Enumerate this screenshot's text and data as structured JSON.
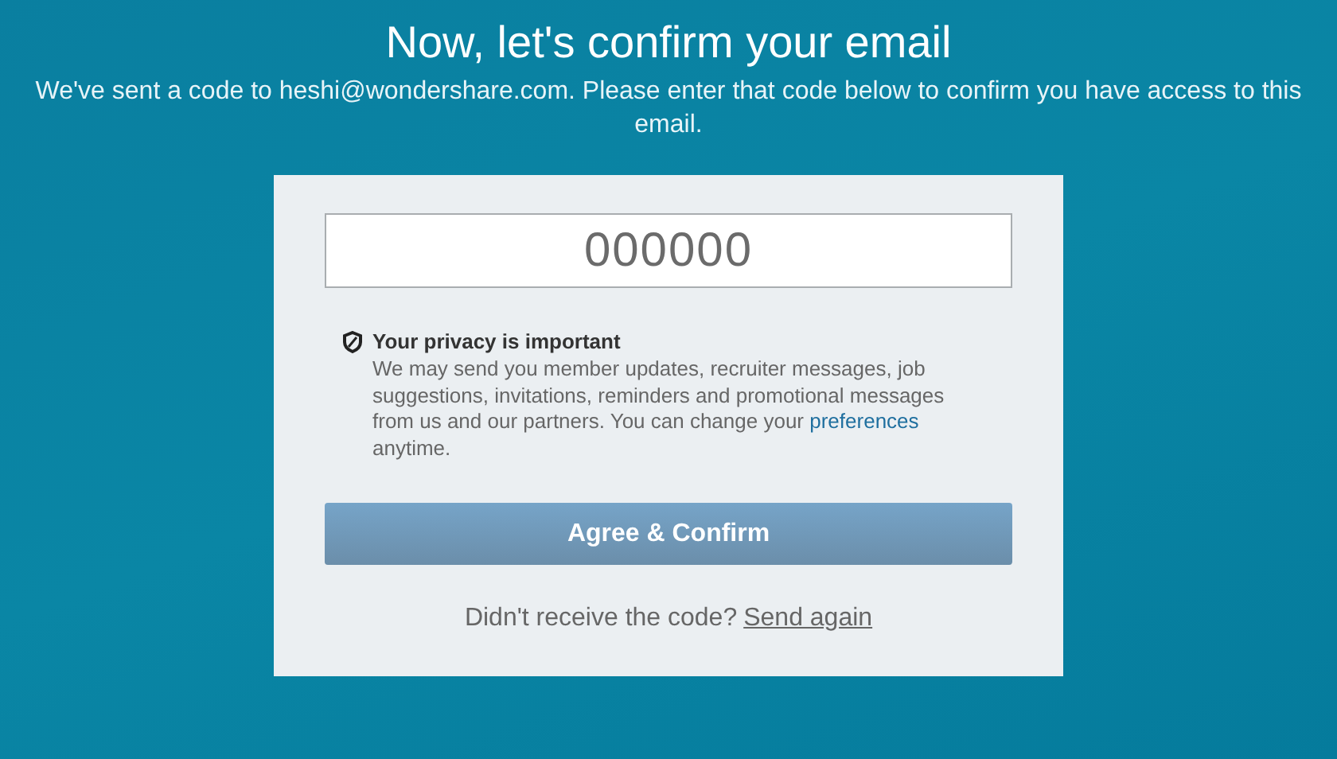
{
  "header": {
    "title": "Now, let's confirm your email",
    "subtitle": "We've sent a code to heshi@wondershare.com. Please enter that code below to confirm you have access to this email."
  },
  "code_field": {
    "placeholder": "000000"
  },
  "privacy": {
    "title": "Your privacy is important",
    "text_before": "We may send you member updates, recruiter messages, job suggestions, invitations, reminders and promotional messages from us and our partners. You can change your ",
    "link": "preferences",
    "text_after": " anytime."
  },
  "confirm_button": {
    "label": "Agree & Confirm"
  },
  "resend": {
    "prompt": "Didn't receive the code?",
    "link": "Send again"
  }
}
